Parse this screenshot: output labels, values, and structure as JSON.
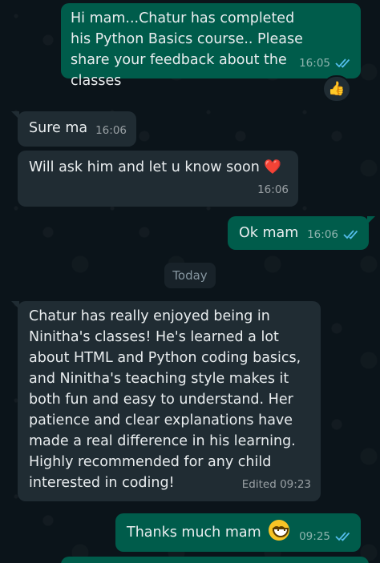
{
  "messages": {
    "m1": {
      "text": "Hi mam...Chatur has completed his Python Basics course.. Please share your feedback about the classes",
      "time": "16:05",
      "reaction": "👍"
    },
    "m2": {
      "text": "Sure ma",
      "time": "16:06"
    },
    "m3": {
      "text": "Will ask him and let u know soon",
      "emoji": "❤️",
      "time": "16:06"
    },
    "m4": {
      "text": "Ok mam",
      "time": "16:06"
    },
    "day_separator": "Today",
    "m5": {
      "text": "Chatur has really enjoyed being in Ninitha's classes! He's learned a lot about HTML and Python coding basics, and Ninitha's teaching style makes it both fun and easy to understand. Her patience and clear explanations have made a real difference in his learning. Highly recommended for any child interested in coding!",
      "time": "Edited 09:23"
    },
    "m6": {
      "text": "Thanks much mam",
      "time": "09:25"
    }
  },
  "colors": {
    "background": "#0b141a",
    "outgoing_bubble": "#005c4b",
    "incoming_bubble": "#202c33",
    "read_ticks": "#53bdeb"
  }
}
